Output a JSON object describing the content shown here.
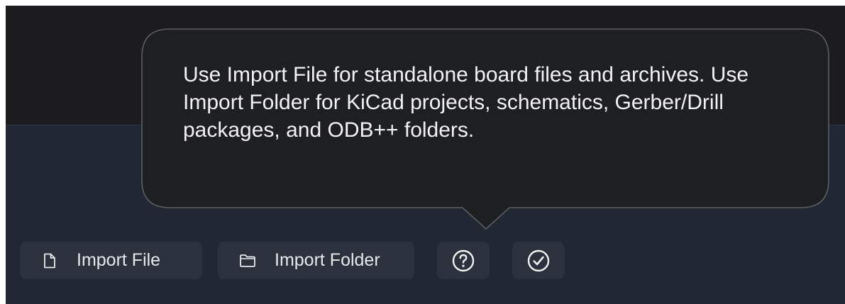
{
  "tooltip": {
    "text": "Use Import File for standalone board files and archives. Use Import Folder for KiCad projects, schematics, Gerber/Drill packages, and ODB++ folders."
  },
  "toolbar": {
    "import_file_label": "Import File",
    "import_folder_label": "Import Folder",
    "icons": [
      "file-icon",
      "folder-icon",
      "help-icon",
      "checkmark-circle-icon"
    ]
  },
  "colors": {
    "top_background": "#1c1c1e",
    "bottom_background": "#212733",
    "button_background": "#2c323d",
    "tooltip_background": "#1e1f21",
    "text": "#e8e8ea"
  }
}
